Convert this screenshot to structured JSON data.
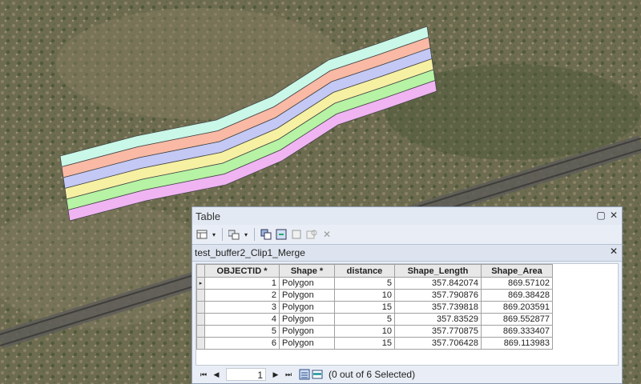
{
  "window": {
    "title": "Table",
    "minimize_glyph": "▢",
    "close_glyph": "✕"
  },
  "tab": {
    "name": "test_buffer2_Clip1_Merge",
    "close_glyph": "✕"
  },
  "toolbar": {
    "icons": [
      "table-options-icon",
      "related-tables-icon",
      "select-by-attributes-icon",
      "switch-selection-icon",
      "clear-selection-icon",
      "zoom-to-selected-icon",
      "delete-selected-icon"
    ]
  },
  "table": {
    "headers": [
      "OBJECTID *",
      "Shape *",
      "distance",
      "Shape_Length",
      "Shape_Area"
    ],
    "rows": [
      {
        "objectid": "1",
        "shape": "Polygon",
        "distance": "5",
        "length": "357.842074",
        "area": "869.57102"
      },
      {
        "objectid": "2",
        "shape": "Polygon",
        "distance": "10",
        "length": "357.790876",
        "area": "869.38428"
      },
      {
        "objectid": "3",
        "shape": "Polygon",
        "distance": "15",
        "length": "357.739818",
        "area": "869.203591"
      },
      {
        "objectid": "4",
        "shape": "Polygon",
        "distance": "5",
        "length": "357.83529",
        "area": "869.552877"
      },
      {
        "objectid": "5",
        "shape": "Polygon",
        "distance": "10",
        "length": "357.770875",
        "area": "869.333407"
      },
      {
        "objectid": "6",
        "shape": "Polygon",
        "distance": "15",
        "length": "357.706428",
        "area": "869.113983"
      }
    ],
    "current_row_marker": "▸"
  },
  "status": {
    "first": "⏮",
    "prev": "◀",
    "page": "1",
    "next": "▶",
    "last": "⏭",
    "selection_text": "(0 out of 6 Selected)"
  },
  "colors": {
    "buffer_bands": [
      "#c9f7e8",
      "#f9b9a4",
      "#c4c8f4",
      "#f6f0a2",
      "#b6f3a4",
      "#f0b4f2"
    ]
  }
}
